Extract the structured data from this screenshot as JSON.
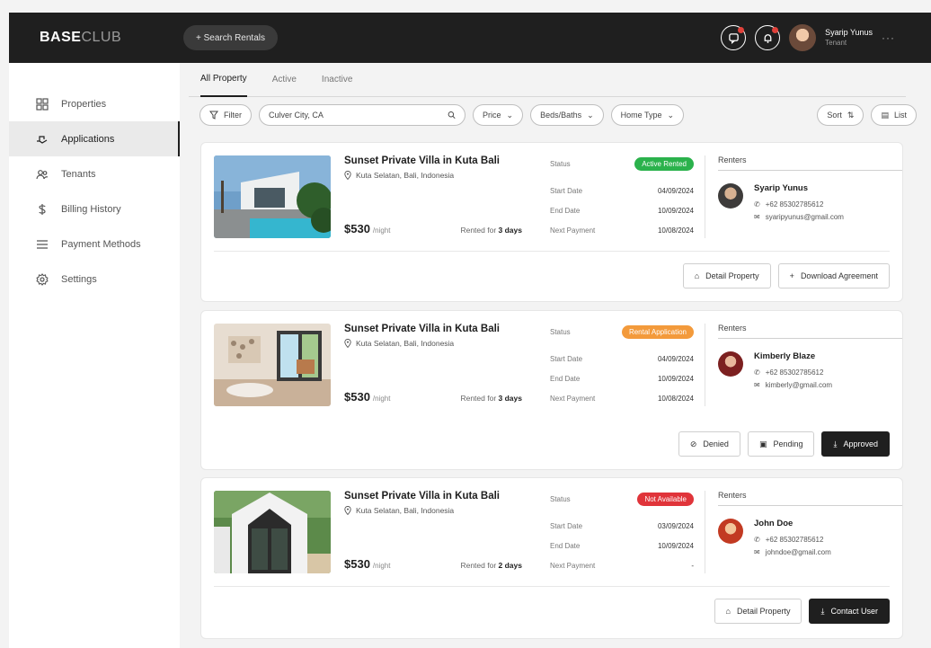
{
  "header": {
    "brand_bold": "BASE",
    "brand_light": "CLUB",
    "search_label": "+ Search Rentals",
    "user_name": "Syarip Yunus",
    "user_role": "Tenant"
  },
  "sidebar": {
    "items": [
      {
        "label": "Properties",
        "icon": "grid-icon"
      },
      {
        "label": "Applications",
        "icon": "hand-icon"
      },
      {
        "label": "Tenants",
        "icon": "users-icon"
      },
      {
        "label": "Billing History",
        "icon": "dollar-icon"
      },
      {
        "label": "Payment Methods",
        "icon": "list-icon"
      },
      {
        "label": "Settings",
        "icon": "gear-icon"
      }
    ]
  },
  "tabs": [
    "All Property",
    "Active",
    "Inactive"
  ],
  "filters": {
    "filter_label": "Filter",
    "location": "Culver City, CA",
    "price": "Price",
    "beds": "Beds/Baths",
    "home_type": "Home Type",
    "sort": "Sort",
    "view": "List"
  },
  "cards": [
    {
      "title": "Sunset Private Villa in Kuta Bali",
      "address": "Kuta Selatan, Bali, Indonesia",
      "price": "$530",
      "per": "/night",
      "rented_prefix": "Rented for ",
      "rented_days": "3 days",
      "status_label": "Status",
      "badge": "Active Rented",
      "badge_color": "#2bb24c",
      "start_label": "Start Date",
      "start": "04/09/2024",
      "end_label": "End Date",
      "end": "10/09/2024",
      "next_label": "Next Payment",
      "next": "10/08/2024",
      "renter_head": "Renters",
      "renter_name": "Syarip Yunus",
      "renter_phone": "+62 85302785612",
      "renter_email": "syaripyunus@gmail.com",
      "actions": [
        "Detail Property",
        "Download Agreement"
      ]
    },
    {
      "title": "Sunset Private Villa in Kuta Bali",
      "address": "Kuta Selatan, Bali, Indonesia",
      "price": "$530",
      "per": "/night",
      "rented_prefix": "Rented for ",
      "rented_days": "3 days",
      "status_label": "Status",
      "badge": "Rental Application",
      "badge_color": "#f39a3b",
      "start_label": "Start Date",
      "start": "04/09/2024",
      "end_label": "End Date",
      "end": "10/09/2024",
      "next_label": "Next Payment",
      "next": "10/08/2024",
      "renter_head": "Renters",
      "renter_name": "Kimberly Blaze",
      "renter_phone": "+62 85302785612",
      "renter_email": "kimberly@gmail.com",
      "actions": [
        "Denied",
        "Pending",
        "Approved"
      ]
    },
    {
      "title": "Sunset Private Villa in Kuta Bali",
      "address": "Kuta Selatan, Bali, Indonesia",
      "price": "$530",
      "per": "/night",
      "rented_prefix": "Rented for ",
      "rented_days": "2 days",
      "status_label": "Status",
      "badge": "Not Available",
      "badge_color": "#e0343a",
      "start_label": "Start Date",
      "start": "03/09/2024",
      "end_label": "End Date",
      "end": "10/09/2024",
      "next_label": "Next Payment",
      "next": "-",
      "renter_head": "Renters",
      "renter_name": "John Doe",
      "renter_phone": "+62 85302785612",
      "renter_email": "johndoe@gmail.com",
      "actions": [
        "Detail Property",
        "Contact User"
      ]
    }
  ]
}
